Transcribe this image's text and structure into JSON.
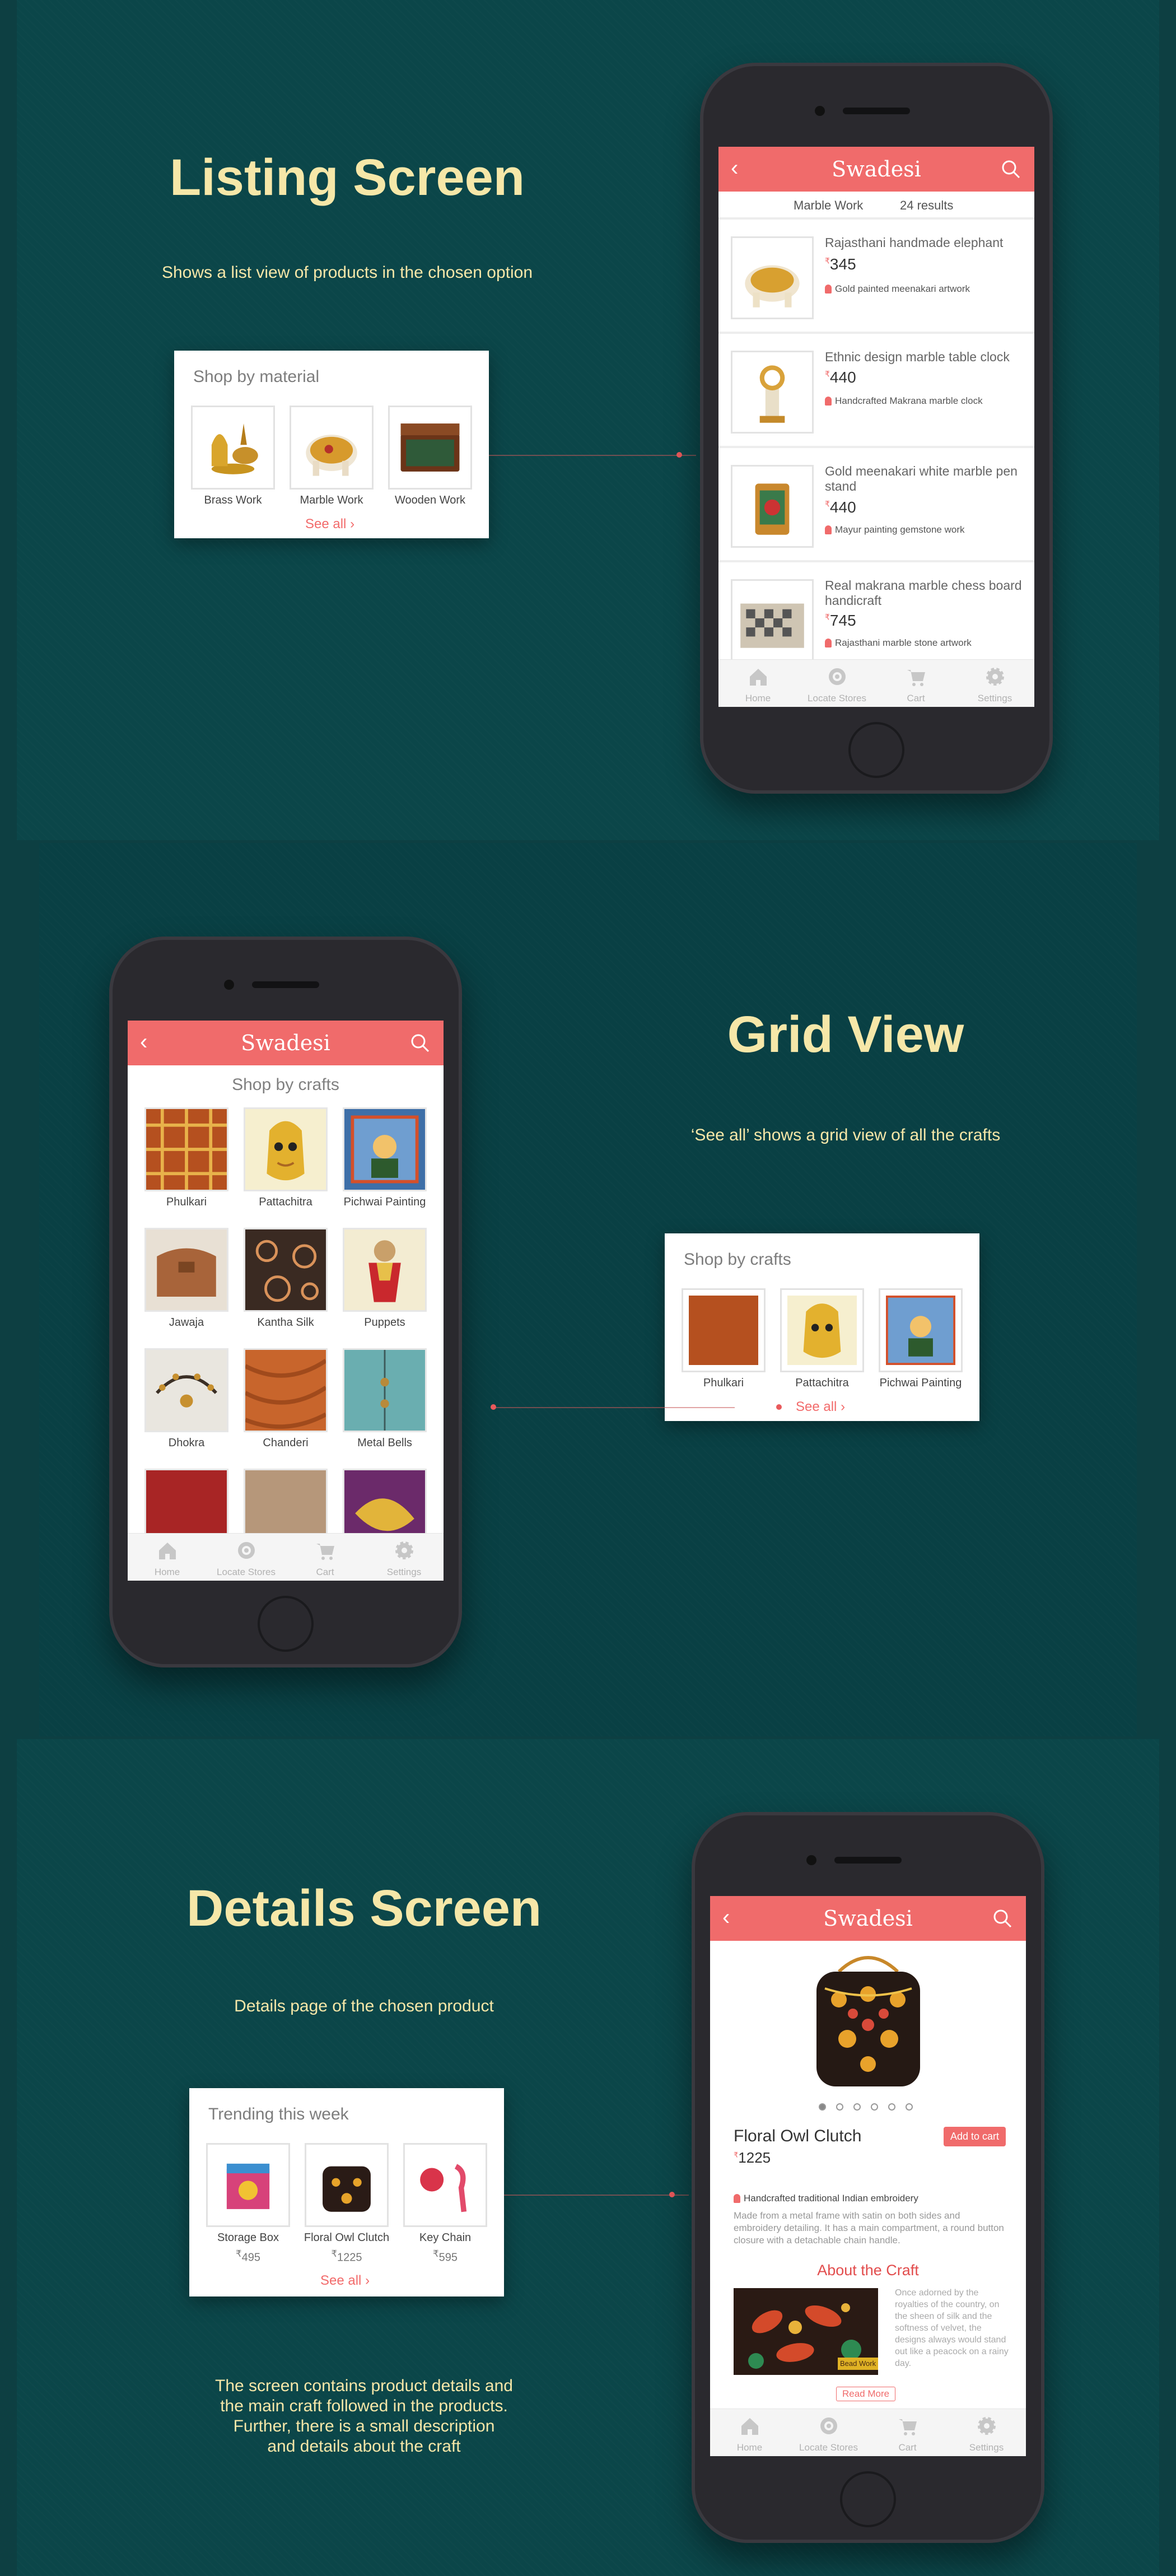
{
  "colors": {
    "background": "#0d3f42",
    "accent": "#f06b6b",
    "headline": "#f6e7a8"
  },
  "app": {
    "brand": "Swadesi"
  },
  "tabs": [
    {
      "label": "Home",
      "icon": "home-icon"
    },
    {
      "label": "Locate Stores",
      "icon": "locate-icon"
    },
    {
      "label": "Cart",
      "icon": "cart-icon"
    },
    {
      "label": "Settings",
      "icon": "settings-icon"
    }
  ],
  "listing": {
    "headline": "Listing Screen",
    "subtext": "Shows a list view of products in the chosen option",
    "widget": {
      "title": "Shop by material",
      "items": [
        {
          "label": "Brass Work"
        },
        {
          "label": "Marble Work"
        },
        {
          "label": "Wooden Work"
        }
      ],
      "see_all": "See all"
    },
    "phone": {
      "category": "Marble Work",
      "result_count": "24 results",
      "products": [
        {
          "title": "Rajasthani handmade elephant",
          "currency": "₹",
          "price": "345",
          "meta": "Gold painted meenakari artwork"
        },
        {
          "title": "Ethnic design marble table clock",
          "currency": "₹",
          "price": "440",
          "meta": "Handcrafted Makrana marble clock"
        },
        {
          "title": "Gold meenakari white marble pen stand",
          "currency": "₹",
          "price": "440",
          "meta": "Mayur painting gemstone work"
        },
        {
          "title": "Real makrana marble chess board handicraft",
          "currency": "₹",
          "price": "745",
          "meta": "Rajasthani marble stone artwork"
        }
      ]
    }
  },
  "grid": {
    "headline": "Grid View",
    "subtext": "‘See all’ shows a grid view of all the crafts",
    "widget": {
      "title": "Shop by crafts",
      "items": [
        {
          "label": "Phulkari"
        },
        {
          "label": "Pattachitra"
        },
        {
          "label": "Pichwai Painting"
        }
      ],
      "see_all": "See all"
    },
    "phone": {
      "title": "Shop by crafts",
      "crafts": [
        {
          "label": "Phulkari"
        },
        {
          "label": "Pattachitra"
        },
        {
          "label": "Pichwai Painting"
        },
        {
          "label": "Jawaja"
        },
        {
          "label": "Kantha Silk"
        },
        {
          "label": "Puppets"
        },
        {
          "label": "Dhokra"
        },
        {
          "label": "Chanderi"
        },
        {
          "label": "Metal Bells"
        },
        {
          "label": ""
        },
        {
          "label": ""
        },
        {
          "label": ""
        }
      ]
    }
  },
  "details": {
    "headline": "Details Screen",
    "subtext": "Details page of the chosen product",
    "description_lines": [
      "The screen contains product details and",
      "the main craft followed in the products.",
      "Further, there is a small description",
      "and details about the craft"
    ],
    "widget": {
      "title": "Trending this week",
      "items": [
        {
          "label": "Storage Box",
          "currency": "₹",
          "price": "495"
        },
        {
          "label": "Floral Owl Clutch",
          "currency": "₹",
          "price": "1225"
        },
        {
          "label": "Key Chain",
          "currency": "₹",
          "price": "595"
        }
      ],
      "see_all": "See all"
    },
    "phone": {
      "product_name": "Floral Owl Clutch",
      "currency": "₹",
      "price": "1225",
      "add_to_cart": "Add to cart",
      "meta": "Handcrafted traditional Indian embroidery",
      "description": "Made from a metal frame with satin on both sides and embroidery detailing. It has a main compartment, a round button closure with a detachable chain handle.",
      "craft_heading": "About the Craft",
      "craft_image_tag": "Bead Work",
      "craft_text": "Once adorned by the royalties of the country, on the sheen of silk and the softness of velvet, the designs always would stand out like a peacock on a rainy day.",
      "read_more": "Read More",
      "carousel_pages": 6,
      "carousel_active": 1
    }
  }
}
